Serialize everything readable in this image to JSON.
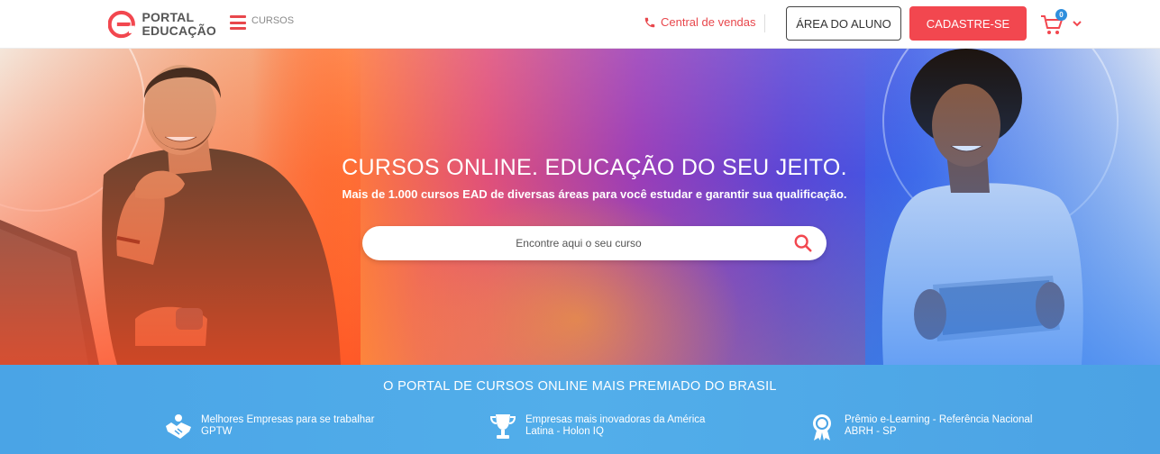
{
  "header": {
    "logo_line1": "PORTAL",
    "logo_line2": "EDUCAÇÃO",
    "menu_label": "CURSOS",
    "sales_label": "Central de vendas",
    "student_area_label": "ÁREA DO ALUNO",
    "signup_label": "CADASTRE-SE",
    "cart_count": "0",
    "colors": {
      "brand": "#f2474f",
      "badge": "#2f8fdd"
    },
    "icons": {
      "menu": "hamburger-icon",
      "sales": "phone-icon",
      "cart": "cart-icon",
      "dropdown": "chevron-down-icon"
    }
  },
  "hero": {
    "title": "CURSOS ONLINE. EDUCAÇÃO DO SEU JEITO.",
    "subtitle": "Mais de 1.000 cursos EAD de diversas áreas para você estudar e garantir sua qualificação.",
    "search_placeholder": "Encontre aqui o seu curso",
    "search_icon": "search-icon"
  },
  "awards": {
    "title": "O PORTAL DE CURSOS ONLINE MAIS PREMIADO DO BRASIL",
    "items": [
      {
        "line1": "Melhores Empresas para se trabalhar",
        "line2": "GPTW",
        "icon": "handshake-icon"
      },
      {
        "line1": "Empresas mais inovadoras da América",
        "line2": "Latina - Holon IQ",
        "icon": "trophy-icon"
      },
      {
        "line1": "Prêmio e-Learning - Referência Nacional",
        "line2": "ABRH - SP",
        "icon": "medal-icon"
      }
    ]
  }
}
